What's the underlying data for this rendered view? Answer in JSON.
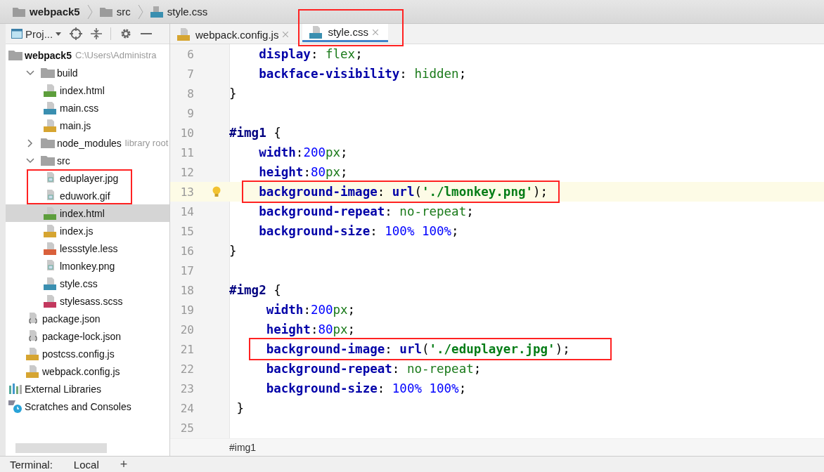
{
  "breadcrumb": [
    {
      "label": "webpack5",
      "kind": "folder",
      "bold": true
    },
    {
      "label": "src",
      "kind": "folder",
      "bold": false
    },
    {
      "label": "style.css",
      "kind": "css",
      "bold": false
    }
  ],
  "project_panel": {
    "title": "Proj...",
    "tree": [
      {
        "label": "webpack5",
        "hint": "C:\\Users\\Administra",
        "kind": "folder",
        "selected": false,
        "highlighted": false,
        "children": [
          {
            "label": "build",
            "kind": "folder",
            "expanded": true,
            "selected": false,
            "highlighted": false,
            "children": [
              {
                "label": "index.html",
                "kind": "html",
                "selected": false,
                "highlighted": false
              },
              {
                "label": "main.css",
                "kind": "css",
                "selected": false,
                "highlighted": false
              },
              {
                "label": "main.js",
                "kind": "js",
                "selected": false,
                "highlighted": false
              }
            ]
          },
          {
            "label": "node_modules",
            "hint": "library root",
            "kind": "folder",
            "expanded": false,
            "selected": false,
            "highlighted": false
          },
          {
            "label": "src",
            "kind": "folder",
            "expanded": true,
            "selected": false,
            "highlighted": false,
            "children": [
              {
                "label": "eduplayer.jpg",
                "kind": "image",
                "selected": false,
                "highlighted": true
              },
              {
                "label": "eduwork.gif",
                "kind": "image",
                "selected": false,
                "highlighted": true
              },
              {
                "label": "index.html",
                "kind": "html",
                "selected": true,
                "highlighted": false
              },
              {
                "label": "index.js",
                "kind": "js",
                "selected": false,
                "highlighted": false
              },
              {
                "label": "lessstyle.less",
                "kind": "less",
                "selected": false,
                "highlighted": false
              },
              {
                "label": "lmonkey.png",
                "kind": "image",
                "selected": false,
                "highlighted": false
              },
              {
                "label": "style.css",
                "kind": "css",
                "selected": false,
                "highlighted": false
              },
              {
                "label": "stylesass.scss",
                "kind": "sass",
                "selected": false,
                "highlighted": false
              }
            ]
          },
          {
            "label": "package.json",
            "kind": "json",
            "selected": false,
            "highlighted": false
          },
          {
            "label": "package-lock.json",
            "kind": "json",
            "selected": false,
            "highlighted": false
          },
          {
            "label": "postcss.config.js",
            "kind": "js",
            "selected": false,
            "highlighted": false
          },
          {
            "label": "webpack.config.js",
            "kind": "js",
            "selected": false,
            "highlighted": false
          }
        ]
      },
      {
        "label": "External Libraries",
        "kind": "libraries",
        "selected": false,
        "highlighted": false
      },
      {
        "label": "Scratches and Consoles",
        "kind": "scratches",
        "selected": false,
        "highlighted": false
      }
    ]
  },
  "tabs": [
    {
      "label": "webpack.config.js",
      "kind": "js",
      "selected": false,
      "highlighted": false
    },
    {
      "label": "style.css",
      "kind": "css",
      "selected": true,
      "highlighted": true
    }
  ],
  "code_lines": [
    {
      "number": "6",
      "current": false,
      "highlighted": false,
      "tokens": [
        {
          "text": "    display",
          "kind": "prop"
        },
        {
          "text": ": ",
          "kind": "punct"
        },
        {
          "text": "flex",
          "kind": "value"
        },
        {
          "text": ";",
          "kind": "punct"
        }
      ]
    },
    {
      "number": "7",
      "current": false,
      "highlighted": false,
      "tokens": [
        {
          "text": "    backface-visibility",
          "kind": "prop"
        },
        {
          "text": ": ",
          "kind": "punct"
        },
        {
          "text": "hidden",
          "kind": "value"
        },
        {
          "text": ";",
          "kind": "punct"
        }
      ]
    },
    {
      "number": "8",
      "current": false,
      "highlighted": false,
      "tokens": [
        {
          "text": "}",
          "kind": "punct"
        }
      ]
    },
    {
      "number": "9",
      "current": false,
      "highlighted": false
    },
    {
      "number": "10",
      "current": false,
      "highlighted": false,
      "tokens": [
        {
          "text": "#img1",
          "kind": "selector"
        },
        {
          "text": " {",
          "kind": "punct"
        }
      ]
    },
    {
      "number": "11",
      "current": false,
      "highlighted": false,
      "tokens": [
        {
          "text": "    width",
          "kind": "prop"
        },
        {
          "text": ":",
          "kind": "punct"
        },
        {
          "text": "200",
          "kind": "num"
        },
        {
          "text": "px",
          "kind": "value"
        },
        {
          "text": ";",
          "kind": "punct"
        }
      ]
    },
    {
      "number": "12",
      "current": false,
      "highlighted": false,
      "tokens": [
        {
          "text": "    height",
          "kind": "prop"
        },
        {
          "text": ":",
          "kind": "punct"
        },
        {
          "text": "80",
          "kind": "num"
        },
        {
          "text": "px",
          "kind": "value"
        },
        {
          "text": ";",
          "kind": "punct"
        }
      ]
    },
    {
      "number": "13",
      "current": true,
      "highlighted": true,
      "tokens": [
        {
          "text": "    background-image",
          "kind": "prop"
        },
        {
          "text": ": ",
          "kind": "punct"
        },
        {
          "text": "url",
          "kind": "prop"
        },
        {
          "text": "(",
          "kind": "punct"
        },
        {
          "text": "'./lmonkey.png'",
          "kind": "string"
        },
        {
          "text": ");",
          "kind": "punct"
        }
      ]
    },
    {
      "number": "14",
      "current": false,
      "highlighted": false,
      "tokens": [
        {
          "text": "    background-repeat",
          "kind": "prop"
        },
        {
          "text": ": ",
          "kind": "punct"
        },
        {
          "text": "no-repeat",
          "kind": "value"
        },
        {
          "text": ";",
          "kind": "punct"
        }
      ]
    },
    {
      "number": "15",
      "current": false,
      "highlighted": false,
      "tokens": [
        {
          "text": "    background-size",
          "kind": "prop"
        },
        {
          "text": ": ",
          "kind": "punct"
        },
        {
          "text": "100% 100%",
          "kind": "num"
        },
        {
          "text": ";",
          "kind": "punct"
        }
      ]
    },
    {
      "number": "16",
      "current": false,
      "highlighted": false,
      "tokens": [
        {
          "text": "}",
          "kind": "punct"
        }
      ]
    },
    {
      "number": "17",
      "current": false,
      "highlighted": false
    },
    {
      "number": "18",
      "current": false,
      "highlighted": false,
      "tokens": [
        {
          "text": "#img2",
          "kind": "selector"
        },
        {
          "text": " {",
          "kind": "punct"
        }
      ]
    },
    {
      "number": "19",
      "current": false,
      "highlighted": false,
      "tokens": [
        {
          "text": "     width",
          "kind": "prop"
        },
        {
          "text": ":",
          "kind": "punct"
        },
        {
          "text": "200",
          "kind": "num"
        },
        {
          "text": "px",
          "kind": "value"
        },
        {
          "text": ";",
          "kind": "punct"
        }
      ]
    },
    {
      "number": "20",
      "current": false,
      "highlighted": false,
      "tokens": [
        {
          "text": "     height",
          "kind": "prop"
        },
        {
          "text": ":",
          "kind": "punct"
        },
        {
          "text": "80",
          "kind": "num"
        },
        {
          "text": "px",
          "kind": "value"
        },
        {
          "text": ";",
          "kind": "punct"
        }
      ]
    },
    {
      "number": "21",
      "current": false,
      "highlighted": true,
      "tokens": [
        {
          "text": "     background-image",
          "kind": "prop"
        },
        {
          "text": ": ",
          "kind": "punct"
        },
        {
          "text": "url",
          "kind": "prop"
        },
        {
          "text": "(",
          "kind": "punct"
        },
        {
          "text": "'./eduplayer.jpg'",
          "kind": "string"
        },
        {
          "text": ");",
          "kind": "punct"
        }
      ]
    },
    {
      "number": "22",
      "current": false,
      "highlighted": false,
      "tokens": [
        {
          "text": "     background-repeat",
          "kind": "prop"
        },
        {
          "text": ": ",
          "kind": "punct"
        },
        {
          "text": "no-repeat",
          "kind": "value"
        },
        {
          "text": ";",
          "kind": "punct"
        }
      ]
    },
    {
      "number": "23",
      "current": false,
      "highlighted": false,
      "tokens": [
        {
          "text": "     background-size",
          "kind": "prop"
        },
        {
          "text": ": ",
          "kind": "punct"
        },
        {
          "text": "100% 100%",
          "kind": "num"
        },
        {
          "text": ";",
          "kind": "punct"
        }
      ]
    },
    {
      "number": "24",
      "current": false,
      "highlighted": false,
      "tokens": [
        {
          "text": " }",
          "kind": "punct"
        }
      ]
    },
    {
      "number": "25",
      "current": false,
      "highlighted": false
    }
  ],
  "editor_breadcrumb": "#img1",
  "terminal_bar": {
    "label": "Terminal:",
    "tab": "Local",
    "add": "+"
  }
}
